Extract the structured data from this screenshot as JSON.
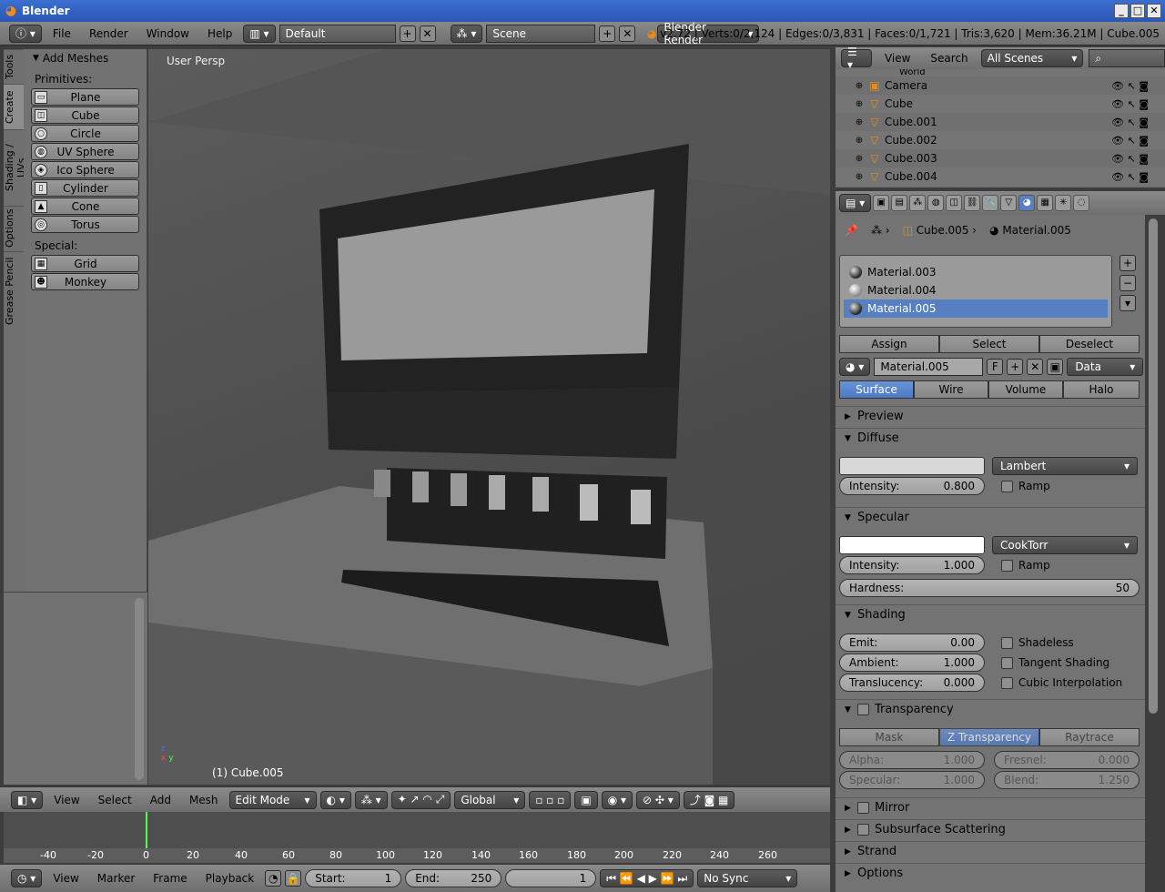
{
  "window": {
    "title": "Blender"
  },
  "topbar": {
    "menus": [
      "File",
      "Render",
      "Window",
      "Help"
    ],
    "layout": "Default",
    "scene": "Scene",
    "engine": "Blender Render",
    "stats": "v2.72 | Verts:0/2,124 | Edges:0/3,831 | Faces:0/1,721 | Tris:3,620 | Mem:36.21M | Cube.005"
  },
  "lefttabs": [
    "Tools",
    "Create",
    "Shading / UVs",
    "Options",
    "Grease Pencil"
  ],
  "toolpanel": {
    "title": "Add Meshes",
    "primitives_label": "Primitives:",
    "primitives": [
      "Plane",
      "Cube",
      "Circle",
      "UV Sphere",
      "Ico Sphere",
      "Cylinder",
      "Cone",
      "Torus"
    ],
    "special_label": "Special:",
    "special": [
      "Grid",
      "Monkey"
    ]
  },
  "viewport": {
    "view_label": "User Persp",
    "object_label": "(1) Cube.005"
  },
  "vheader": {
    "menus": [
      "View",
      "Select",
      "Add",
      "Mesh"
    ],
    "mode": "Edit Mode",
    "orientation": "Global"
  },
  "timeline": {
    "ticks": [
      "-40",
      "-20",
      "0",
      "20",
      "40",
      "60",
      "80",
      "100",
      "120",
      "140",
      "160",
      "180",
      "200",
      "220",
      "240",
      "260"
    ],
    "menus": [
      "View",
      "Marker",
      "Frame",
      "Playback"
    ],
    "start_label": "Start:",
    "start": "1",
    "end_label": "End:",
    "end": "250",
    "current": "1",
    "sync": "No Sync"
  },
  "outliner": {
    "menus": [
      "View",
      "Search"
    ],
    "filter": "All Scenes",
    "partial_top": "World",
    "items": [
      "Camera",
      "Cube",
      "Cube.001",
      "Cube.002",
      "Cube.003",
      "Cube.004"
    ]
  },
  "properties": {
    "breadcrumb_object": "Cube.005",
    "breadcrumb_material": "Material.005",
    "materials": [
      "Material.003",
      "Material.004",
      "Material.005"
    ],
    "assign": "Assign",
    "select": "Select",
    "deselect": "Deselect",
    "material_name": "Material.005",
    "fake_user": "F",
    "link": "Data",
    "types": [
      "Surface",
      "Wire",
      "Volume",
      "Halo"
    ],
    "preview": "Preview",
    "diffuse": {
      "title": "Diffuse",
      "shader": "Lambert",
      "intensity_label": "Intensity:",
      "intensity": "0.800",
      "ramp": "Ramp",
      "color": "#d8d8d8"
    },
    "specular": {
      "title": "Specular",
      "shader": "CookTorr",
      "intensity_label": "Intensity:",
      "intensity": "1.000",
      "ramp": "Ramp",
      "hardness_label": "Hardness:",
      "hardness": "50",
      "color": "#ffffff"
    },
    "shading": {
      "title": "Shading",
      "emit_label": "Emit:",
      "emit": "0.00",
      "ambient_label": "Ambient:",
      "ambient": "1.000",
      "transl_label": "Translucency:",
      "transl": "0.000",
      "shadeless": "Shadeless",
      "tangent": "Tangent Shading",
      "cubic": "Cubic Interpolation"
    },
    "transparency": {
      "title": "Transparency",
      "modes": [
        "Mask",
        "Z Transparency",
        "Raytrace"
      ],
      "alpha_label": "Alpha:",
      "alpha": "1.000",
      "fresnel_label": "Fresnel:",
      "fresnel": "0.000",
      "spec_label": "Specular:",
      "spec": "1.000",
      "blend_label": "Blend:",
      "blend": "1.250"
    },
    "mirror": "Mirror",
    "sss": "Subsurface Scattering",
    "strand": "Strand",
    "options": "Options"
  }
}
